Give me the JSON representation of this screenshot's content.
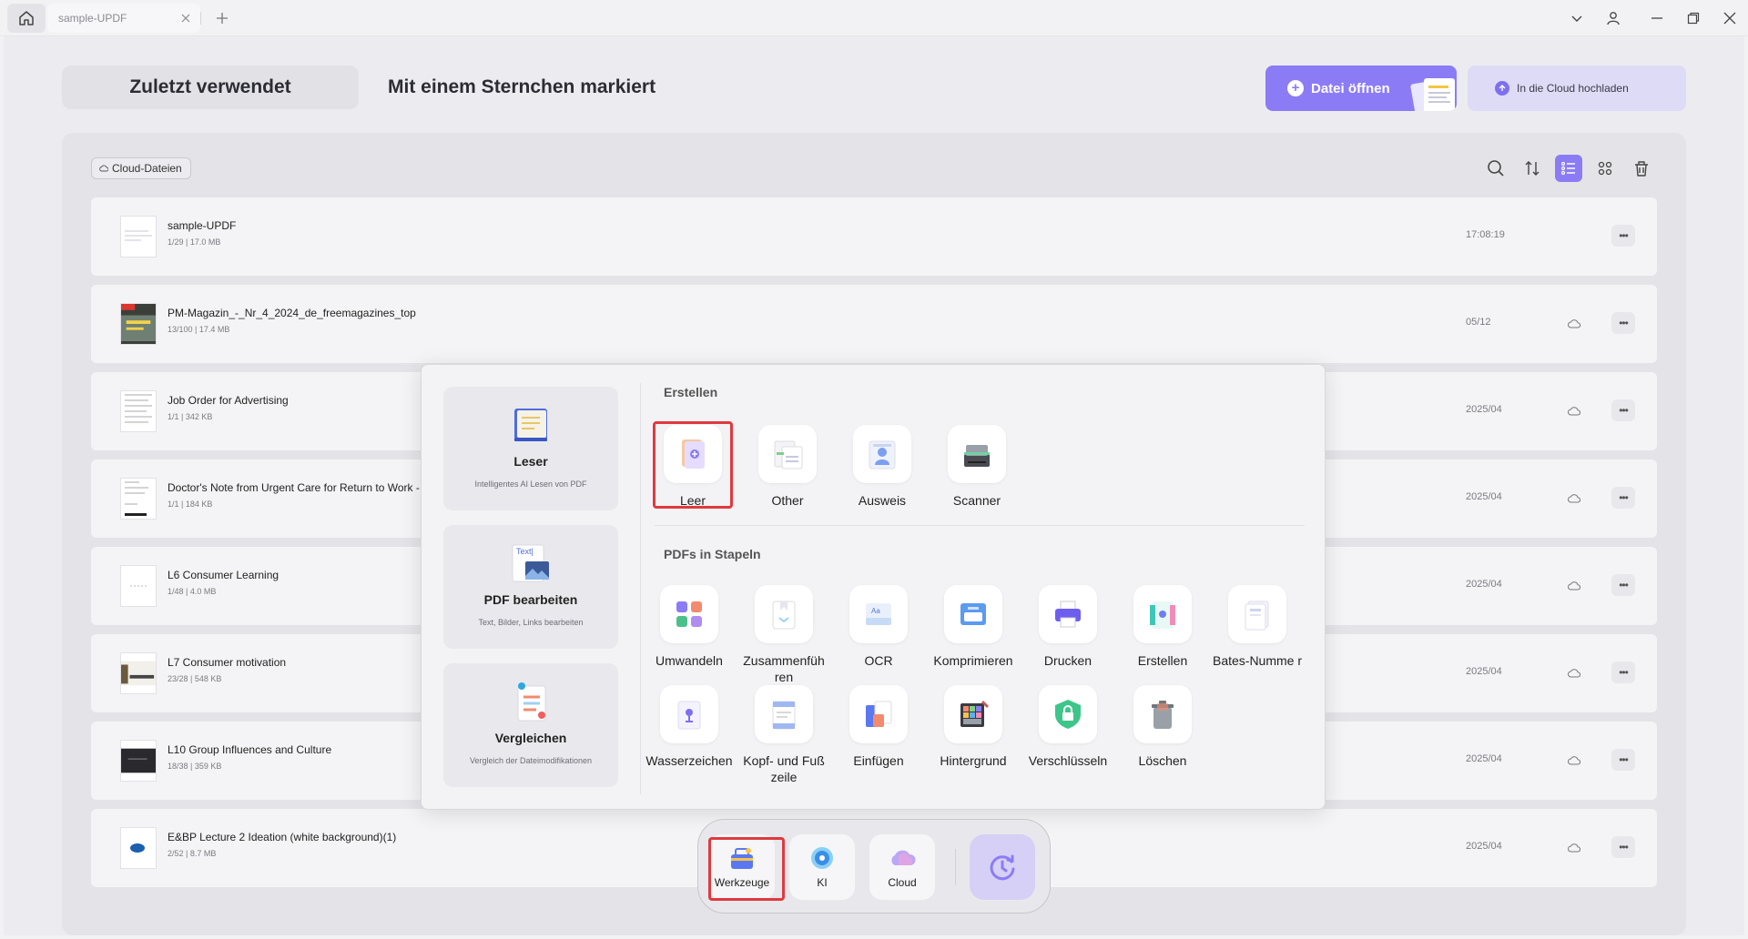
{
  "window": {
    "tab_title": "sample-UPDF"
  },
  "nav": {
    "recent": "Zuletzt verwendet",
    "starred": "Mit einem Sternchen markiert"
  },
  "actions": {
    "open_file": "Datei öffnen",
    "upload_cloud": "In die Cloud hochladen"
  },
  "filter": {
    "cloud_chip": "Cloud-Dateien"
  },
  "files": [
    {
      "name": "sample-UPDF",
      "meta": "1/29 | 17.0 MB",
      "date": "17:08:19",
      "cloud": false
    },
    {
      "name": "PM-Magazin_-_Nr_4_2024_de_freemagazines_top",
      "meta": "13/100 | 17.4 MB",
      "date": "05/12",
      "cloud": true
    },
    {
      "name": "Job Order for Advertising",
      "meta": "1/1 | 342 KB",
      "date": "2025/04",
      "cloud": true
    },
    {
      "name": "Doctor's Note from Urgent Care for Return to Work -",
      "meta": "1/1 | 184 KB",
      "date": "2025/04",
      "cloud": true
    },
    {
      "name": "L6  Consumer Learning",
      "meta": "1/48 | 4.0 MB",
      "date": "2025/04",
      "cloud": true
    },
    {
      "name": "L7 Consumer motivation",
      "meta": "23/28 | 548 KB",
      "date": "2025/04",
      "cloud": true
    },
    {
      "name": "L10  Group Influences and Culture",
      "meta": "18/38 | 359 KB",
      "date": "2025/04",
      "cloud": true
    },
    {
      "name": "E&BP Lecture 2 Ideation (white background)(1)",
      "meta": "2/52 | 8.7 MB",
      "date": "2025/04",
      "cloud": true
    }
  ],
  "popup": {
    "features": [
      {
        "title": "Leser",
        "subtitle": "Intelligentes AI Lesen von PDF"
      },
      {
        "title": "PDF bearbeiten",
        "subtitle": "Text, Bilder, Links bearbeiten",
        "icon_text": "Text|"
      },
      {
        "title": "Vergleichen",
        "subtitle": "Vergleich der Dateimodifikationen"
      }
    ],
    "create_title": "Erstellen",
    "create_tools": [
      "Leer",
      "Other",
      "Ausweis",
      "Scanner"
    ],
    "batch_title": "PDFs in Stapeln",
    "batch_tools": [
      "Umwandeln",
      "Zusammenfüh ren",
      "OCR",
      "Komprimieren",
      "Drucken",
      "Erstellen",
      "Bates-Numme r",
      "Wasserzeichen",
      "Kopf- und Fuß zeile",
      "Einfügen",
      "Hintergrund",
      "Verschlüsseln",
      "Löschen"
    ]
  },
  "dock": {
    "tools": "Werkzeuge",
    "ai": "KI",
    "cloud": "Cloud"
  },
  "colors": {
    "accent": "#8b7cf6",
    "highlight": "#e0393e"
  }
}
